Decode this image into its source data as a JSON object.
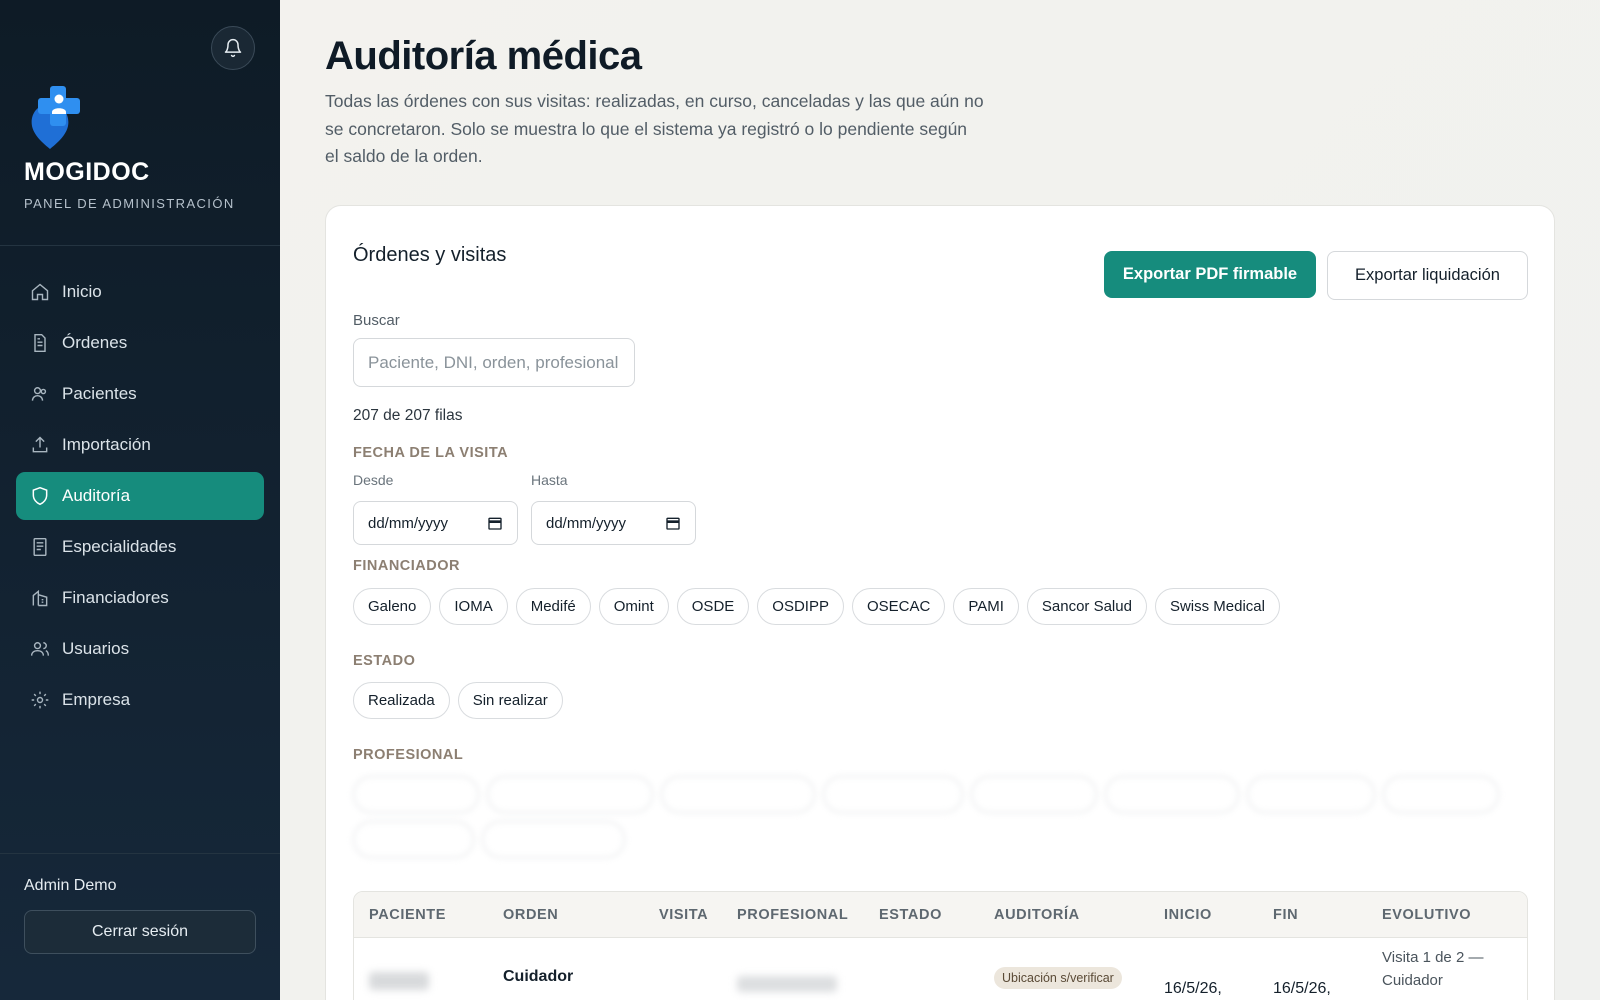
{
  "sidebar": {
    "brand": "MOGIDOC",
    "brand_sub": "PANEL DE ADMINISTRACIÓN",
    "nav": [
      {
        "label": "Inicio",
        "icon": "home-icon"
      },
      {
        "label": "Órdenes",
        "icon": "document-icon"
      },
      {
        "label": "Pacientes",
        "icon": "patients-icon"
      },
      {
        "label": "Importación",
        "icon": "upload-icon"
      },
      {
        "label": "Auditoría",
        "icon": "shield-icon",
        "active": true
      },
      {
        "label": "Especialidades",
        "icon": "book-icon"
      },
      {
        "label": "Financiadores",
        "icon": "building-icon"
      },
      {
        "label": "Usuarios",
        "icon": "users-icon"
      },
      {
        "label": "Empresa",
        "icon": "gear-icon"
      }
    ],
    "user": "Admin Demo",
    "logout": "Cerrar sesión"
  },
  "header": {
    "title": "Auditoría médica",
    "subtitle": "Todas las órdenes con sus visitas: realizadas, en curso, canceladas y las que aún no se concretaron. Solo se muestra lo que el sistema ya registró o lo pendiente según el saldo de la orden."
  },
  "card": {
    "title": "Órdenes y visitas",
    "export_pdf": "Exportar PDF firmable",
    "export_liq": "Exportar liquidación",
    "search_label": "Buscar",
    "search_placeholder": "Paciente, DNI, orden, profesional",
    "rows_count": "207 de 207 filas",
    "date_section": "FECHA DE LA VISITA",
    "from_label": "Desde",
    "to_label": "Hasta",
    "date_placeholder": "dd/mm/yyyy",
    "financiador_section": "FINANCIADOR",
    "financiadores": [
      "Galeno",
      "IOMA",
      "Medifé",
      "Omint",
      "OSDE",
      "OSDIPP",
      "OSECAC",
      "PAMI",
      "Sancor Salud",
      "Swiss Medical"
    ],
    "estado_section": "ESTADO",
    "estados": [
      "Realizada",
      "Sin realizar"
    ],
    "profesional_section": "PROFESIONAL"
  },
  "table": {
    "headers": [
      "PACIENTE",
      "ORDEN",
      "VISITA",
      "PROFESIONAL",
      "ESTADO",
      "AUDITORÍA",
      "INICIO",
      "FIN",
      "EVOLUTIVO"
    ],
    "first_row": {
      "orden": "Cuidador",
      "auditoria_badge": "Ubicación s/verificar",
      "inicio": "16/5/26,",
      "fin": "16/5/26,",
      "evolutivo_1": "Visita 1 de 2 —",
      "evolutivo_2": "Cuidador"
    }
  },
  "colors": {
    "accent": "#168c7d",
    "sidebar": "#0e1b26"
  }
}
